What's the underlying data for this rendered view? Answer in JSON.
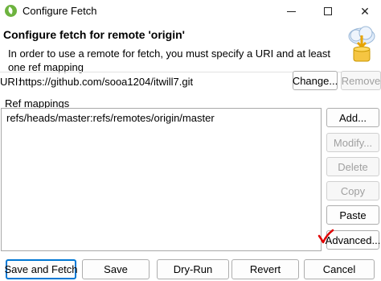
{
  "window": {
    "title": "Configure Fetch",
    "minimize": "—",
    "maximize": "☐",
    "close": "✕"
  },
  "header": {
    "title": "Configure fetch for remote 'origin'",
    "message": "In order to use a remote for fetch, you must specify a URI and at least one ref mapping"
  },
  "uri": {
    "label": "URI:",
    "value": "https://github.com/sooa1204/itwill7.git",
    "change_label": "Change...",
    "remove_label": "Remove"
  },
  "ref_mappings": {
    "label": "Ref mappings",
    "items": [
      "refs/heads/master:refs/remotes/origin/master"
    ],
    "buttons": {
      "add": "Add...",
      "modify": "Modify...",
      "delete": "Delete",
      "copy": "Copy",
      "paste": "Paste",
      "advanced": "Advanced..."
    }
  },
  "footer": {
    "save_and_fetch": "Save and Fetch",
    "save": "Save",
    "dry_run": "Dry-Run",
    "revert": "Revert",
    "cancel": "Cancel"
  },
  "colors": {
    "accent": "#0078d4",
    "annotation": "#e00000"
  }
}
